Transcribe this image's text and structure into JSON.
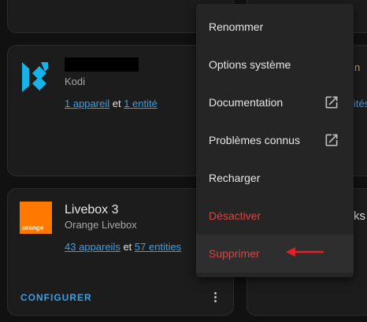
{
  "kodi": {
    "subtitle": "Kodi",
    "devices_link": "1 appareil",
    "joiner": "et",
    "entities_link": "1 entité"
  },
  "livebox": {
    "title": "Livebox 3",
    "subtitle": "Orange Livebox",
    "logo_text": "orange",
    "devices_link": "43 appareils",
    "joiner": "et",
    "entities_link": "57 entities",
    "configure_label": "CONFIGURER"
  },
  "menu": {
    "items": [
      {
        "label": "Renommer"
      },
      {
        "label": "Options système"
      },
      {
        "label": "Documentation"
      },
      {
        "label": "Problèmes connus"
      },
      {
        "label": "Recharger"
      },
      {
        "label": "Désactiver"
      },
      {
        "label": "Supprimer"
      }
    ]
  },
  "right_partial": {
    "mid_title": "n",
    "mid_links": "ités",
    "bot_title": "ks"
  },
  "colors": {
    "accent": "#3b9fe6",
    "danger": "#d64545",
    "orange_brand": "#ff7900",
    "kodi_brand": "#17b2e7",
    "annotation_arrow": "#e0202a"
  }
}
